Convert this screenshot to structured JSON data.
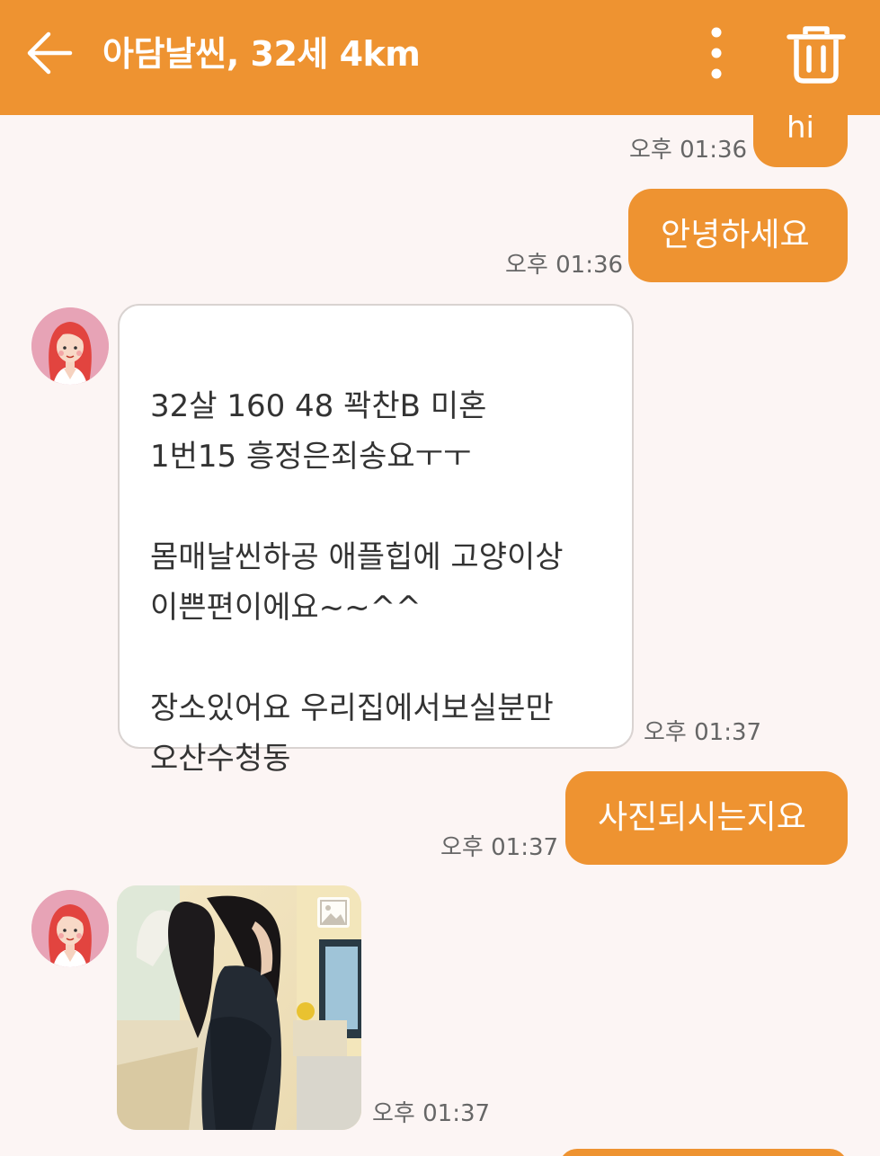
{
  "header": {
    "title": "아담날씬, 32세 4km",
    "back_icon": "arrow-left-icon",
    "menu_icon": "more-vertical-icon",
    "delete_icon": "trash-icon",
    "accent_color": "#ee9331"
  },
  "messages": [
    {
      "direction": "outgoing",
      "text": "hi",
      "time": "오후 01:36"
    },
    {
      "direction": "outgoing",
      "text": "안녕하세요",
      "time": "오후 01:36"
    },
    {
      "direction": "incoming",
      "text": "32살 160 48 꽉찬B 미혼\n1번15  흥정은죄송요ㅜㅜ\n\n몸매날씬하공 애플힙에 고양이상\n이쁜편이에요~~^^\n\n장소있어요 우리집에서보실분만\n오산수청동",
      "time": "오후 01:37"
    },
    {
      "direction": "outgoing",
      "text": "사진되시는지요",
      "time": "오후 01:37"
    },
    {
      "direction": "incoming",
      "type": "photo",
      "badge_icon": "image-icon",
      "time": "오후 01:37"
    }
  ]
}
